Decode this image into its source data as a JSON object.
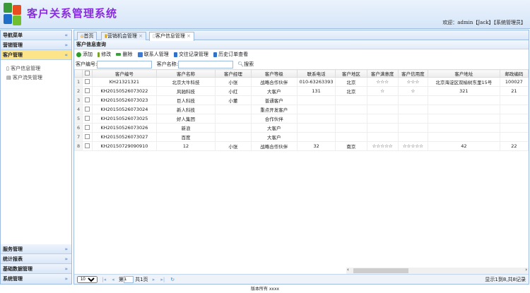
{
  "header": {
    "title": "客户关系管理系统",
    "welcome": "欢迎：admin【Jack】【系统管理员】"
  },
  "sidebar": {
    "title": "导航菜单",
    "groups": [
      {
        "label": "营销管理"
      },
      {
        "label": "客户管理",
        "items": [
          "客户信息管理",
          "客户流失管理"
        ]
      }
    ],
    "bottom": [
      {
        "label": "服务管理"
      },
      {
        "label": "统计报表"
      },
      {
        "label": "基础数据管理"
      },
      {
        "label": "系统管理"
      }
    ]
  },
  "tabs": [
    {
      "label": "首页"
    },
    {
      "label": "营销机会管理"
    },
    {
      "label": "客户信息管理"
    }
  ],
  "panel": {
    "title": "客户信息查询"
  },
  "toolbar": {
    "add": "添加",
    "edit": "修改",
    "delete": "删除",
    "contacts": "联系人管理",
    "interactions": "交往记录管理",
    "orders": "历史订单查看"
  },
  "search": {
    "code_label": "客户编号:",
    "name_label": "客户名称:",
    "button": "搜索"
  },
  "table": {
    "columns": [
      "客户编号",
      "客户名称",
      "客户经理",
      "客户等级",
      "联系电话",
      "客户地区",
      "客户满意度",
      "客户信用度",
      "客户地址",
      "邮政编码"
    ],
    "rows": [
      [
        "1",
        "KH21321321",
        "北京大牛科技",
        "小张",
        "战略合作伙伴",
        "010-63263393",
        "北京",
        "☆☆☆",
        "☆☆☆",
        "北京海淀区双榆树东里15号",
        "100027"
      ],
      [
        "2",
        "KH20150526073022",
        "风驰科技",
        "小红",
        "大客户",
        "131",
        "北京",
        "☆",
        "☆",
        "321",
        "21"
      ],
      [
        "3",
        "KH20150526073023",
        "巨人科技",
        "小董",
        "普通客户",
        "",
        "",
        "",
        "",
        "",
        ""
      ],
      [
        "4",
        "KH20150526073024",
        "新人科技",
        "",
        "重点开发客户",
        "",
        "",
        "",
        "",
        "",
        ""
      ],
      [
        "5",
        "KH20150526073025",
        "好人集团",
        "",
        "合作伙伴",
        "",
        "",
        "",
        "",
        "",
        ""
      ],
      [
        "6",
        "KH20150526073026",
        "新浪",
        "",
        "大客户",
        "",
        "",
        "",
        "",
        "",
        ""
      ],
      [
        "7",
        "KH20150526073027",
        "百度",
        "",
        "大客户",
        "",
        "",
        "",
        "",
        "",
        ""
      ],
      [
        "8",
        "KH20150729090910",
        "12",
        "小张",
        "战略合作伙伴",
        "32",
        "南京",
        "☆☆☆☆☆",
        "☆☆☆☆☆",
        "42",
        "22"
      ]
    ]
  },
  "pager": {
    "page_size": "10",
    "page_prefix": "第",
    "page": "1",
    "page_total": "共1页",
    "info": "显示1到8,共8记录"
  },
  "footer": "版本所有 xxxx"
}
